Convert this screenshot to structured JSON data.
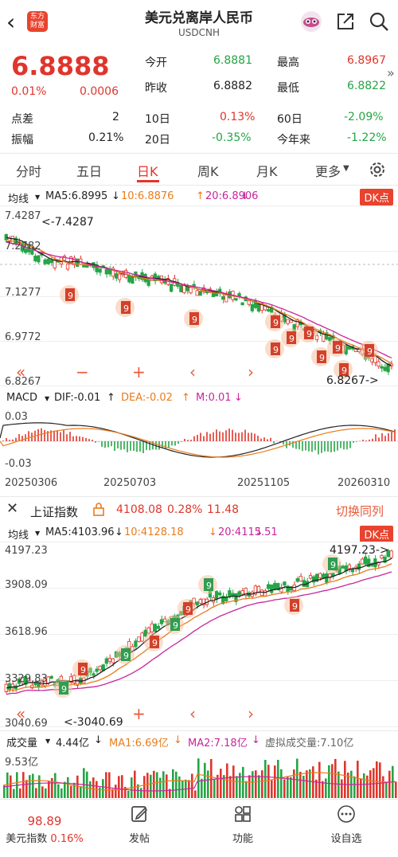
{
  "header": {
    "title": "美元兑离岸人民币",
    "subtitle": "USDCNH",
    "logo_text": "东方\n财富"
  },
  "quote": {
    "price": "6.8888",
    "change_pct": "0.01%",
    "change": "0.0006",
    "open_label": "今开",
    "open": "6.8881",
    "prev_label": "昨收",
    "prev": "6.8882",
    "high_label": "最高",
    "high": "6.8967",
    "low_label": "最低",
    "low": "6.8822",
    "spread_label": "点差",
    "spread": "2",
    "amp_label": "振幅",
    "amp": "0.21%",
    "d10_label": "10日",
    "d10": "0.13%",
    "d20_label": "20日",
    "d20": "-0.35%",
    "d60_label": "60日",
    "d60": "-2.09%",
    "ytd_label": "今年来",
    "ytd": "-1.22%"
  },
  "tabs": [
    "分时",
    "五日",
    "日K",
    "周K",
    "月K",
    "更多"
  ],
  "main_chart": {
    "ma_label": "均线",
    "ma5": "MA5:6.8995",
    "ma10": "10:6.8876",
    "ma20": "20:6.8906",
    "dk_button": "DK点",
    "y_ticks": [
      "7.4287",
      "7.2782",
      "7.1277",
      "6.9772",
      "6.8267"
    ],
    "max_label": "<-7.4287",
    "min_label": "6.8267->",
    "macd_label": "MACD",
    "dif": "DIF:-0.01",
    "dea": "DEA:-0.02",
    "m": "M:0.01",
    "macd_ticks": [
      "0.03",
      "-0.03"
    ],
    "dates": [
      "20250306",
      "20250703",
      "20251105",
      "20260310"
    ]
  },
  "index_panel": {
    "name": "上证指数",
    "value": "4108.08",
    "pct": "0.28%",
    "change": "11.48",
    "switch_label": "切换同列",
    "ma_label": "均线",
    "ma5": "MA5:4103.96",
    "ma10": "10:4128.18",
    "ma20": "20:4115.51",
    "dk_button": "DK点",
    "y_ticks": [
      "4197.23",
      "3908.09",
      "3618.96",
      "3329.83",
      "3040.69"
    ],
    "max_label": "4197.23->",
    "min_label": "<-3040.69",
    "vol_label": "成交量",
    "vol": "4.44亿",
    "ma1": "MA1:6.69亿",
    "ma2": "MA2:7.18亿",
    "virtual": "虚拟成交量:7.10亿",
    "vol_tick": "9.53亿"
  },
  "bottom": {
    "index_value": "98.89",
    "index_name": "美元指数",
    "index_pct": "0.16%",
    "post": "发帖",
    "func": "功能",
    "custom": "设自选"
  },
  "colors": {
    "red": "#e0352c",
    "green": "#25a546",
    "orange": "#e97c1c",
    "purple": "#c8259c"
  }
}
